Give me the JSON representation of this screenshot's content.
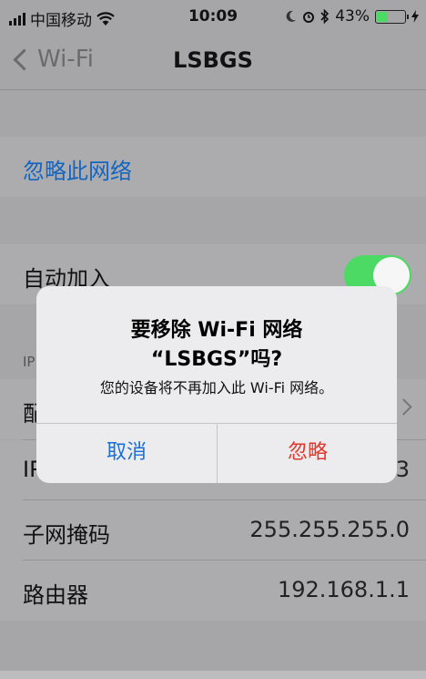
{
  "status_bar": {
    "carrier": "中国移动",
    "time": "10:09",
    "battery_percent": "43%",
    "battery_level": 0.43,
    "icons": [
      "signal-bars-icon",
      "wifi-icon",
      "moon-icon",
      "alarm-icon",
      "bluetooth-icon",
      "battery-icon",
      "charging-icon"
    ]
  },
  "nav": {
    "back_label": "Wi-Fi",
    "title": "LSBGS"
  },
  "settings": {
    "forget_network": "忽略此网络",
    "auto_join": "自动加入",
    "auto_join_on": true,
    "ip_section_fragment": "IP",
    "configure_fragment": "配",
    "ip_row_fragment": "IP",
    "ip_value_fragment": "3",
    "subnet_label": "子网掩码",
    "subnet_value": "255.255.255.0",
    "router_label": "路由器",
    "router_value": "192.168.1.1"
  },
  "alert": {
    "title_line1": "要移除 Wi-Fi 网络",
    "title_line2": "“LSBGS”吗?",
    "message": "您的设备将不再加入此 Wi-Fi 网络。",
    "cancel_label": "取消",
    "ignore_label": "忽略"
  },
  "colors": {
    "link_blue": "#1565c0",
    "toggle_green": "#4cd964",
    "destructive_red": "#e0382e"
  }
}
